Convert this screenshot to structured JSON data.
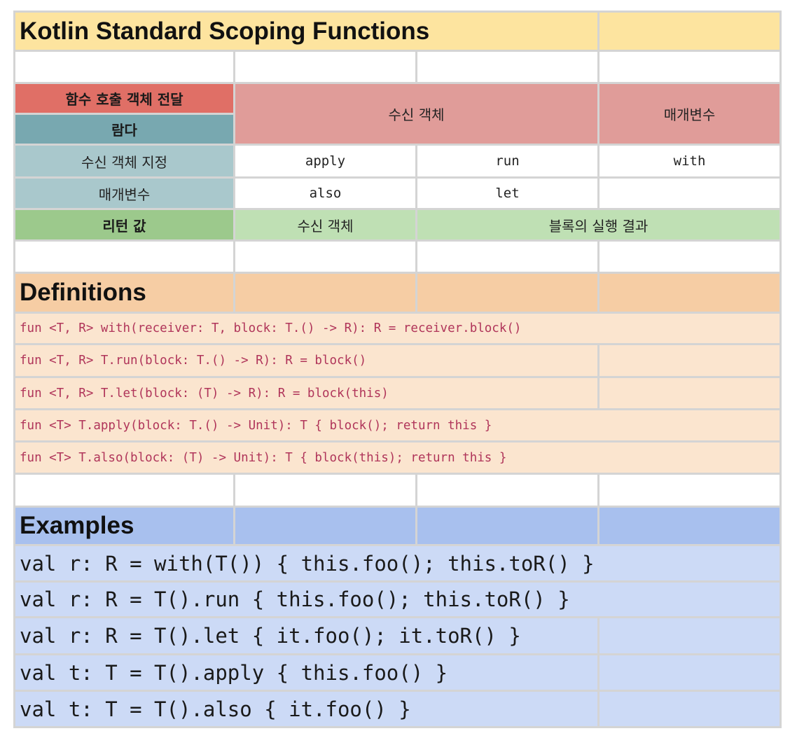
{
  "title": "Kotlin Standard Scoping Functions",
  "colors": {
    "title_bg": "#fde49f",
    "pass_bg": "#e06f66",
    "lambda_bg": "#78a8b0",
    "receiver_header_bg": "#e09c99",
    "row_label_bg": "#a9c8cc",
    "return_label_bg": "#9cc98c",
    "return_value_bg": "#bfe0b4",
    "definitions_header_bg": "#f6cda4",
    "definitions_row_bg": "#fbe5cf",
    "examples_header_bg": "#a8c0ee",
    "examples_row_bg": "#ccdaf6"
  },
  "matrix": {
    "pass_object_label": "함수 호출 객체 전달",
    "lambda_label": "람다",
    "col_receiver_object": "수신 객체",
    "col_parameter": "매개변수",
    "row_receiver_label": "수신 객체 지정",
    "row_receiver_values": [
      "apply",
      "run",
      "with"
    ],
    "row_param_label": "매개변수",
    "row_param_values": [
      "also",
      "let",
      ""
    ],
    "return_label": "리턴 값",
    "return_receiver": "수신 객체",
    "return_block_result": "블록의 실행 결과"
  },
  "definitions": {
    "header": "Definitions",
    "lines": [
      "fun <T, R> with(receiver: T, block: T.() -> R): R = receiver.block()",
      "fun <T, R> T.run(block: T.() -> R): R = block()",
      "fun <T, R> T.let(block: (T) -> R): R = block(this)",
      "fun <T> T.apply(block: T.() -> Unit): T { block(); return this }",
      "fun <T> T.also(block: (T) -> Unit): T { block(this); return this }"
    ]
  },
  "examples": {
    "header": "Examples",
    "lines": [
      "val r: R = with(T()) { this.foo(); this.toR() }",
      "val r: R = T().run { this.foo(); this.toR() }",
      "val r: R = T().let { it.foo(); it.toR() }",
      "val t: T = T().apply { this.foo() }",
      "val t: T = T().also { it.foo() }"
    ]
  }
}
